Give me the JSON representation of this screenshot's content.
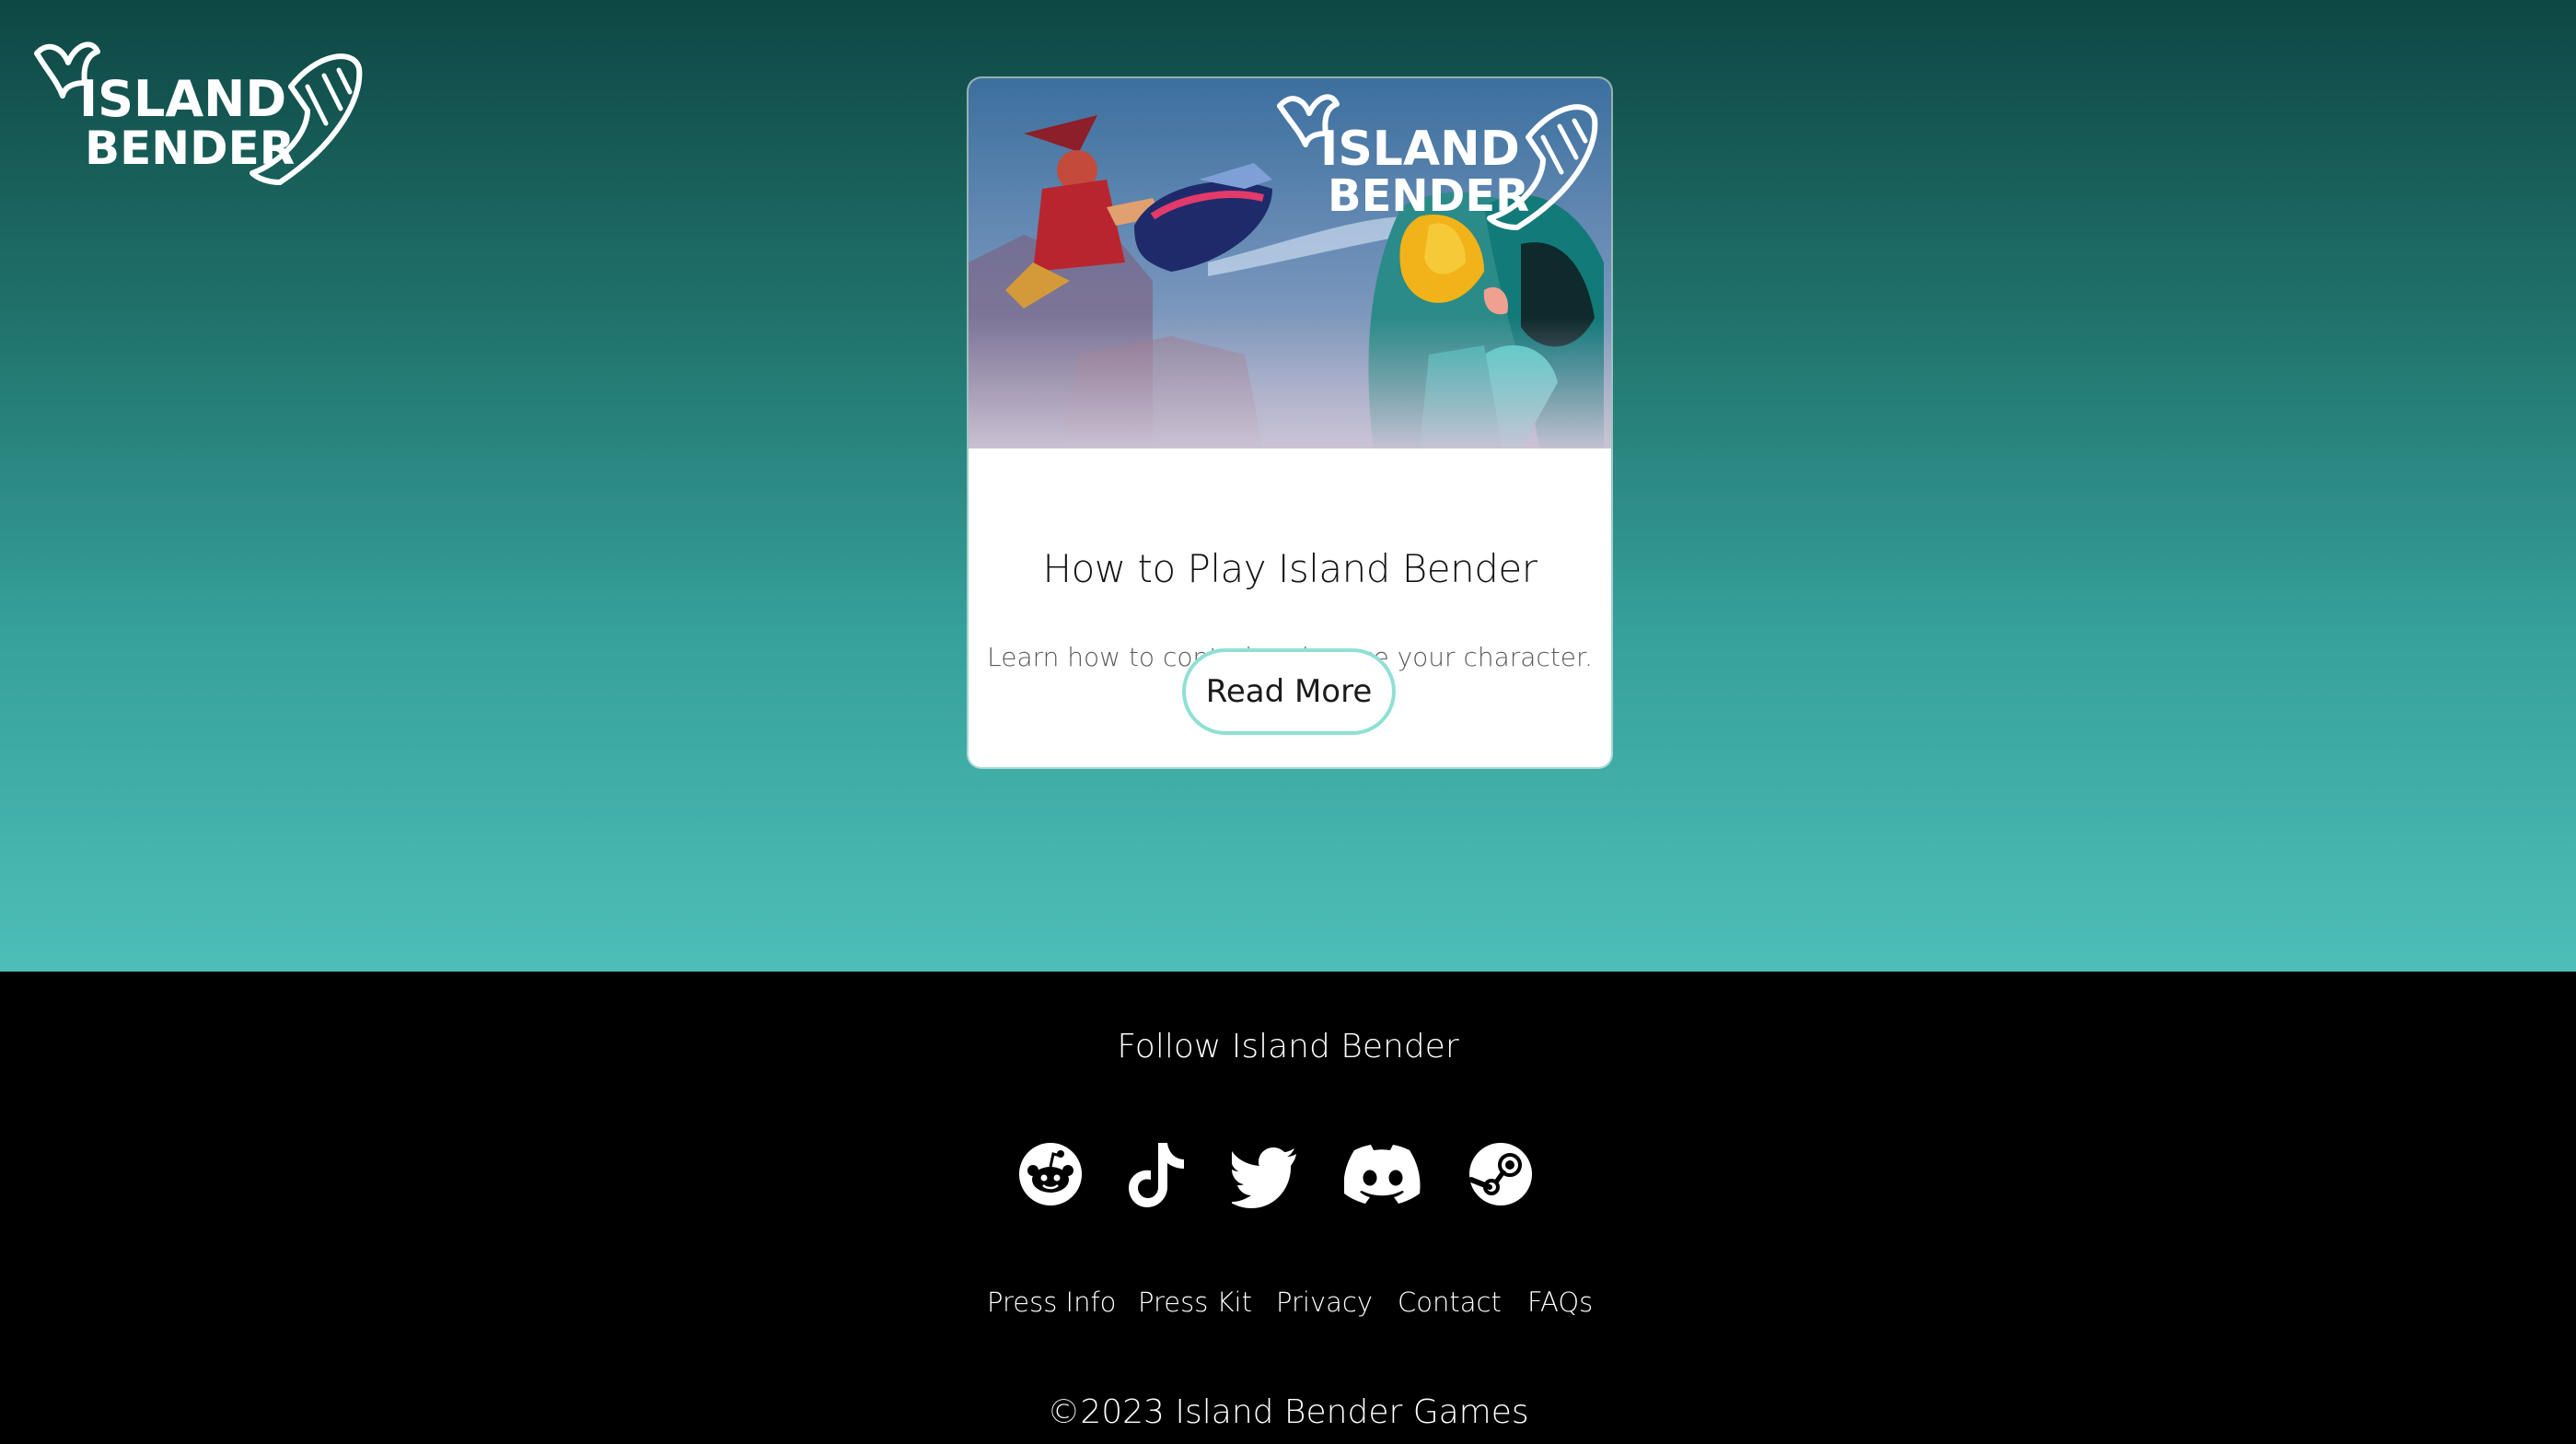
{
  "site": {
    "logo_text_line1": "ISLAND",
    "logo_text_line2": "BENDER"
  },
  "card": {
    "image_logo_line1": "ISLAND",
    "image_logo_line2": "BENDER",
    "title": "How to Play Island Bender",
    "description": "Learn how to control and move your character.",
    "button_label": "Read More"
  },
  "footer": {
    "follow_title": "Follow Island Bender",
    "social_icons": [
      "reddit-icon",
      "tiktok-icon",
      "twitter-icon",
      "discord-icon",
      "steam-icon"
    ],
    "links": [
      "Press Info",
      "Press Kit",
      "Privacy",
      "Contact",
      "FAQs"
    ],
    "copyright": "©2023 Island Bender Games"
  },
  "colors": {
    "hero_top": "#0e4744",
    "hero_bottom": "#4dbfb7",
    "button_border": "#8fe0d5",
    "footer_bg": "#000000"
  }
}
